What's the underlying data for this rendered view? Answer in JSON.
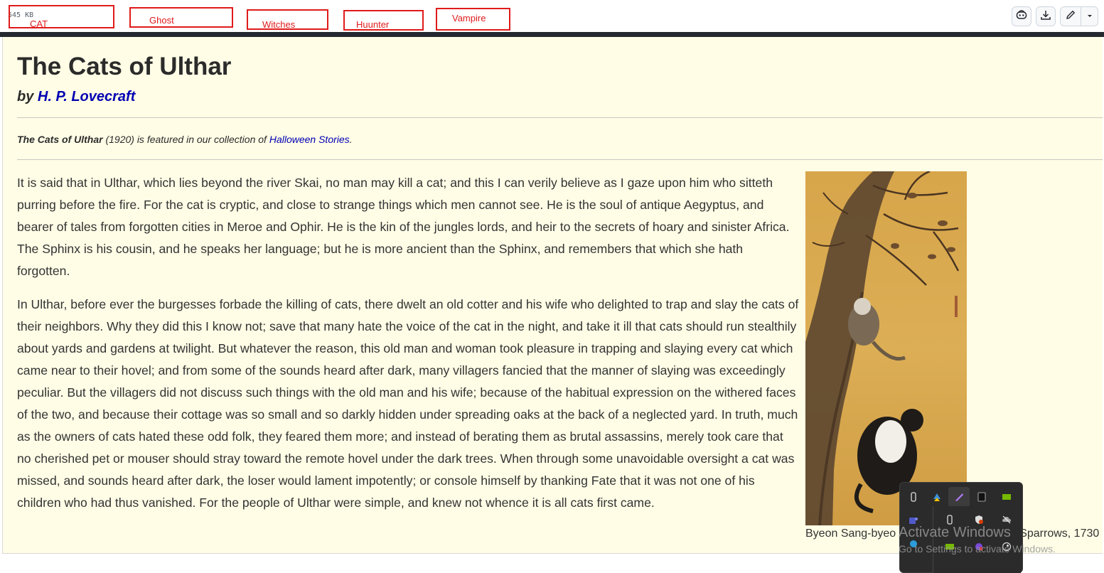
{
  "toolbar": {
    "file_size": "545 KB",
    "tags": [
      "CAT",
      "Ghost",
      "Witches",
      "Huunter",
      "Vampire"
    ],
    "icons": [
      "copilot-icon",
      "download-icon",
      "pencil-icon",
      "chevron-down-icon"
    ],
    "tag_color": "#e01b1b"
  },
  "document": {
    "title": "The Cats of Ulthar",
    "by_prefix": "by ",
    "author": "H. P. Lovecraft",
    "note_title": "The Cats of Ulthar",
    "note_middle": " (1920) is featured in our collection of ",
    "note_link": "Halloween Stories",
    "note_end": ".",
    "paragraphs": [
      "It is said that in Ulthar, which lies beyond the river Skai, no man may kill a cat; and this I can verily believe as I gaze upon him who sitteth purring before the fire. For the cat is cryptic, and close to strange things which men cannot see. He is the soul of antique Aegyptus, and bearer of tales from forgotten cities in Meroe and Ophir. He is the kin of the jungles lords, and heir to the secrets of hoary and sinister Africa. The Sphinx is his cousin, and he speaks her language; but he is more ancient than the Sphinx, and remembers that which she hath forgotten.",
      "In Ulthar, before ever the burgesses forbade the killing of cats, there dwelt an old cotter and his wife who delighted to trap and slay the cats of their neighbors. Why they did this I know not; save that many hate the voice of the cat in the night, and take it ill that cats should run stealthily about yards and gardens at twilight. But whatever the reason, this old man and woman took pleasure in trapping and slaying every cat which came near to their hovel; and from some of the sounds heard after dark, many villagers fancied that the manner of slaying was exceedingly peculiar. But the villagers did not discuss such things with the old man and his wife; because of the habitual expression on the withered faces of the two, and because their cottage was so small and so darkly hidden under spreading oaks at the back of a neglected yard. In truth, much as the owners of cats hated these odd folk, they feared them more; and instead of berating them as brutal assassins, merely took care that no cherished pet or mouser should stray toward the remote hovel under the dark trees. When through some unavoidable oversight a cat was missed, and sounds heard after dark, the loser would lament impotently; or console himself by thanking Fate that it was not one of his children who had thus vanished. For the people of Ulthar were simple, and knew not whence it is all cats first came."
    ],
    "caption_left": "Byeon Sang-byeo",
    "caption_right": "Sparrows, 1730",
    "link_color": "#0000b3",
    "background_color": "#fffde6"
  },
  "overlay": {
    "watermark_title": "Activate Windows",
    "watermark_sub": "Go to Settings to activate Windows."
  }
}
